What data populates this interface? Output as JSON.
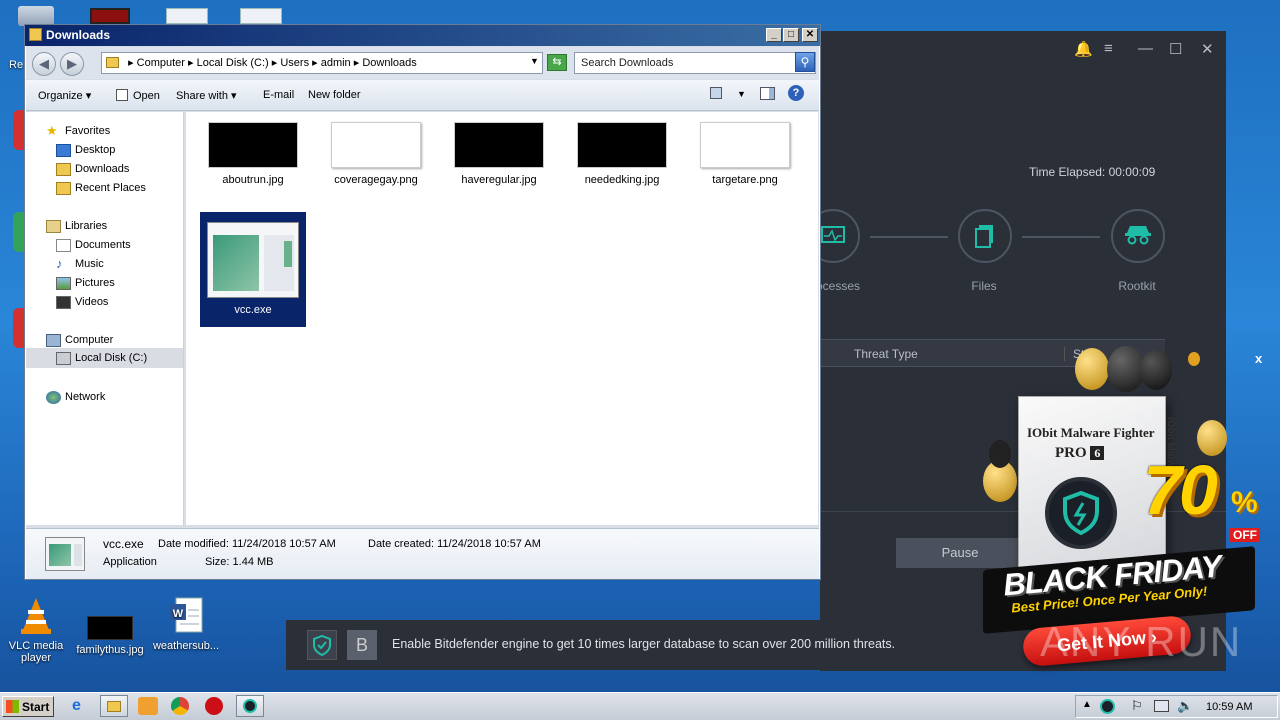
{
  "desktop": {
    "icons": [
      {
        "label": "VLC media player",
        "icon": "vlc-icon"
      },
      {
        "label": "familythus.jpg",
        "icon": "image-file-icon"
      },
      {
        "label": "weathersub...",
        "icon": "word-doc-icon"
      }
    ],
    "partial_label": "Re"
  },
  "iobit": {
    "time_elapsed": "Time Elapsed: 00:00:09",
    "stages": [
      {
        "label": "ocesses",
        "icon": "processes-icon"
      },
      {
        "label": "Files",
        "icon": "files-icon"
      },
      {
        "label": "Rootkit",
        "icon": "rootkit-icon"
      }
    ],
    "table_headers": [
      "Threat Type",
      "Stat"
    ],
    "pause_label": "Pause",
    "notification": "Enable Bitdefender engine to get 10 times larger database to scan over 200 million threats.",
    "notify_badge": "B",
    "colors": {
      "bg": "#2b2f38",
      "accent": "#1fbda8"
    }
  },
  "explorer": {
    "title": "Downloads",
    "breadcrumb": [
      "Computer",
      "Local Disk (C:)",
      "Users",
      "admin",
      "Downloads"
    ],
    "search_placeholder": "Search Downloads",
    "toolbar": {
      "organize": "Organize",
      "open": "Open",
      "share_with": "Share with",
      "email": "E-mail",
      "new_folder": "New folder"
    },
    "nav": {
      "favorites": "Favorites",
      "desktop": "Desktop",
      "downloads": "Downloads",
      "recent_places": "Recent Places",
      "libraries": "Libraries",
      "documents": "Documents",
      "music": "Music",
      "pictures": "Pictures",
      "videos": "Videos",
      "computer": "Computer",
      "local_disk": "Local Disk (C:)",
      "network": "Network"
    },
    "files": [
      {
        "name": "aboutrun.jpg"
      },
      {
        "name": "coveragegay.png"
      },
      {
        "name": "haveregular.jpg"
      },
      {
        "name": "neededking.jpg"
      },
      {
        "name": "targetare.png"
      },
      {
        "name": "vcc.exe"
      }
    ],
    "details": {
      "name": "vcc.exe",
      "type": "Application",
      "date_modified_label": "Date modified:",
      "date_modified": "11/24/2018 10:57 AM",
      "date_created_label": "Date created:",
      "date_created": "11/24/2018 10:57 AM",
      "size_label": "Size:",
      "size": "1.44 MB"
    }
  },
  "ad": {
    "product_line1": "IObit Malware Fighter",
    "product_line2": "PRO",
    "version": "6",
    "side_text": "IObit Malwa",
    "discount": "70",
    "percent": "%",
    "off": "OFF",
    "headline": "BLACK FRIDAY",
    "tagline": "Best Price! Once Per Year Only!",
    "cta": "Get It Now",
    "close": "x"
  },
  "watermark": "ANY RUN",
  "taskbar": {
    "start": "Start",
    "clock": "10:59 AM"
  }
}
